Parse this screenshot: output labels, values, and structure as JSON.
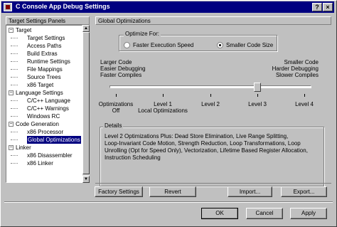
{
  "window": {
    "title": "C Console App Debug Settings"
  },
  "title_buttons": [
    "?",
    "×"
  ],
  "panels_header": "Target Settings Panels",
  "tree": [
    {
      "label": "Target",
      "type": "group",
      "expanded": true
    },
    {
      "label": "Target Settings",
      "type": "item"
    },
    {
      "label": "Access Paths",
      "type": "item"
    },
    {
      "label": "Build Extras",
      "type": "item"
    },
    {
      "label": "Runtime Settings",
      "type": "item"
    },
    {
      "label": "File Mappings",
      "type": "item"
    },
    {
      "label": "Source Trees",
      "type": "item"
    },
    {
      "label": "x86 Target",
      "type": "item"
    },
    {
      "label": "Language Settings",
      "type": "group",
      "expanded": true
    },
    {
      "label": "C/C++ Language",
      "type": "item"
    },
    {
      "label": "C/C++ Warnings",
      "type": "item"
    },
    {
      "label": "Windows RC",
      "type": "item"
    },
    {
      "label": "Code Generation",
      "type": "group",
      "expanded": true
    },
    {
      "label": "x86 Processor",
      "type": "item"
    },
    {
      "label": "Global Optimizations",
      "type": "item",
      "selected": true
    },
    {
      "label": "Linker",
      "type": "group",
      "expanded": true
    },
    {
      "label": "x86 Disassembler",
      "type": "item"
    },
    {
      "label": "x86 Linker",
      "type": "item"
    }
  ],
  "panel": {
    "header": "Global Optimizations",
    "optimize_for": {
      "label": "Optimize For:",
      "options": [
        "Faster Execution Speed",
        "Smaller Code Size"
      ],
      "selected": "Smaller Code Size"
    },
    "left_desc": [
      "Larger Code",
      "Easier Debugging",
      "Faster Compiles"
    ],
    "right_desc": [
      "Smaller Code",
      "Harder Debugging",
      "Slower Compiles"
    ],
    "slider": {
      "levels": [
        {
          "lines": [
            "Optimizations",
            "Off"
          ]
        },
        {
          "lines": [
            "Level 1",
            "Local Optimizations"
          ]
        },
        {
          "lines": [
            "Level 2"
          ]
        },
        {
          "lines": [
            "Level 3"
          ]
        },
        {
          "lines": [
            "Level 4"
          ]
        }
      ],
      "value": 3
    },
    "details": {
      "label": "Details",
      "lines": [
        "Level 2 Optimizations Plus:  Dead Store Elimination, Live Range Splitting,",
        "Loop-Invariant Code Motion, Strength Reduction, Loop Transformations, Loop",
        "Unrolling (Opt for Speed Only), Vectorization, Lifetime Based Register Allocation,",
        "Instruction Scheduling"
      ]
    }
  },
  "buttons": {
    "factory": "Factory Settings",
    "revert": "Revert",
    "import": "Import...",
    "export": "Export...",
    "ok": "OK",
    "cancel": "Cancel",
    "apply": "Apply"
  }
}
